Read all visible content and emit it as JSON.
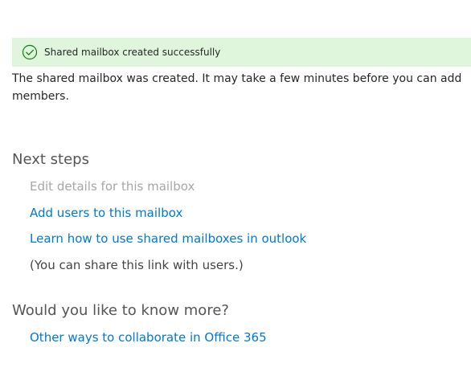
{
  "banner": {
    "message": "Shared mailbox created successfully",
    "icon": "checkmark-circle-icon",
    "background_color": "#dff6dd",
    "icon_color": "#107c10"
  },
  "intro": {
    "text": "The shared mailbox was created. It may take a few minutes before you can add members."
  },
  "next_steps": {
    "title": "Next steps",
    "edit_details_label": "Edit details for this mailbox",
    "add_users_link": "Add users to this mailbox",
    "learn_link": "Learn how to use shared mailboxes in outlook",
    "share_note": "(You can share this link with users.)"
  },
  "know_more": {
    "title": "Would you like to know more?",
    "collaborate_link": "Other ways to collaborate in Office 365"
  },
  "colors": {
    "link": "#0078d4",
    "disabled_text": "#a6a6a6",
    "body_text": "#262626"
  }
}
